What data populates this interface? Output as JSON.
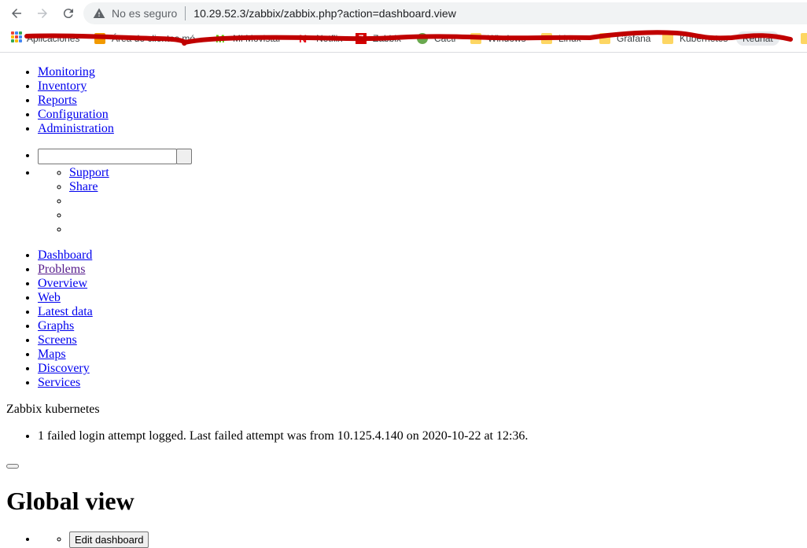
{
  "browser": {
    "security_label": "No es seguro",
    "url": "10.29.52.3/zabbix/zabbix.php?action=dashboard.view",
    "bookmarks": [
      {
        "label": "Aplicaciones",
        "icon": "apps-icon"
      },
      {
        "label": "Área de clientes mó...",
        "icon": "folder-icon"
      },
      {
        "label": "Mi Movistar",
        "icon": "movistar-icon"
      },
      {
        "label": "Netflix",
        "icon": "netflix-icon"
      },
      {
        "label": "Zabbix",
        "icon": "zabbix-icon"
      },
      {
        "label": "Cacti",
        "icon": "cacti-icon"
      },
      {
        "label": "Windows",
        "icon": "folder-icon"
      },
      {
        "label": "Linux",
        "icon": "folder-icon"
      },
      {
        "label": "Grafana",
        "icon": "folder-icon"
      },
      {
        "label": "Kubernetes",
        "icon": "folder-icon"
      },
      {
        "label": "Redhat",
        "icon": "folder-icon"
      }
    ]
  },
  "main_menu": [
    "Monitoring",
    "Inventory",
    "Reports",
    "Configuration",
    "Administration"
  ],
  "user_menu": {
    "search_placeholder": "",
    "search_value": "",
    "links": [
      "Support",
      "Share",
      " ",
      " ",
      " "
    ]
  },
  "sub_menu": [
    "Dashboard",
    "Problems",
    "Overview",
    "Web",
    "Latest data",
    "Graphs",
    "Screens",
    "Maps",
    "Discovery",
    "Services"
  ],
  "server_name": "Zabbix kubernetes",
  "messages": [
    "1 failed login attempt logged. Last failed attempt was from 10.125.4.140 on 2020-10-22 at 12:36."
  ],
  "page_title": "Global view",
  "edit_dashboard_label": "Edit dashboard",
  "colors": {
    "link": "#0000ee",
    "visited_link": "#551a8b",
    "scribble": "#c00000",
    "omnibox_bg": "#f1f3f4"
  }
}
